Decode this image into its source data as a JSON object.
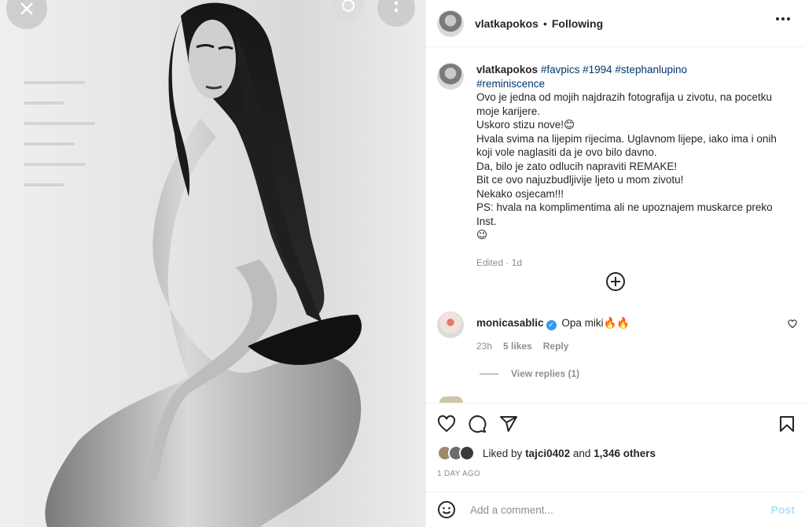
{
  "photo": {
    "close_icon": "close-icon",
    "tag_icon": "people-tag-icon",
    "menu_icon": "more-icon"
  },
  "header": {
    "username": "vlatkapokos",
    "separator": "•",
    "follow_status": "Following",
    "more_icon": "more-horizontal-icon"
  },
  "caption": {
    "username": "vlatkapokos",
    "hashtags": [
      "#favpics",
      "#1994",
      "#stephanlupino",
      "#reminiscence"
    ],
    "lines": [
      "Ovo je jedna od mojih najdrazih fotografija u zivotu, na pocetku moje karijere.",
      "Uskoro stizu nove!😊",
      "Hvala svima na lijepim rijecima. Uglavnom lijepe, iako ima i onih koji vole naglasiti da je ovo bilo davno.",
      "Da, bilo je zato odlucih napraviti REMAKE!",
      "Bit ce ovo najuzbudljivije ljeto u mom zivotu!",
      "Nekako osjecam!!!",
      "PS: hvala na komplimentima ali ne upoznajem muskarce preko Inst.",
      "😉"
    ],
    "edited": "Edited",
    "dot": "·",
    "time": "1d"
  },
  "comment": {
    "username": "monicasablic",
    "verified_mark": "✓",
    "text": "Opa miki🔥🔥",
    "time": "23h",
    "likes": "5 likes",
    "reply": "Reply",
    "view_replies": "View replies (1)"
  },
  "actions": {
    "like_icon": "heart-icon",
    "comment_icon": "comment-icon",
    "share_icon": "share-icon",
    "save_icon": "bookmark-icon"
  },
  "likes": {
    "prefix": "Liked by",
    "user": "tajci0402",
    "and": "and",
    "others": "1,346 others"
  },
  "posted_ago": "1 DAY AGO",
  "add_comment": {
    "placeholder": "Add a comment...",
    "post": "Post",
    "emoji_icon": "emoji-icon"
  }
}
